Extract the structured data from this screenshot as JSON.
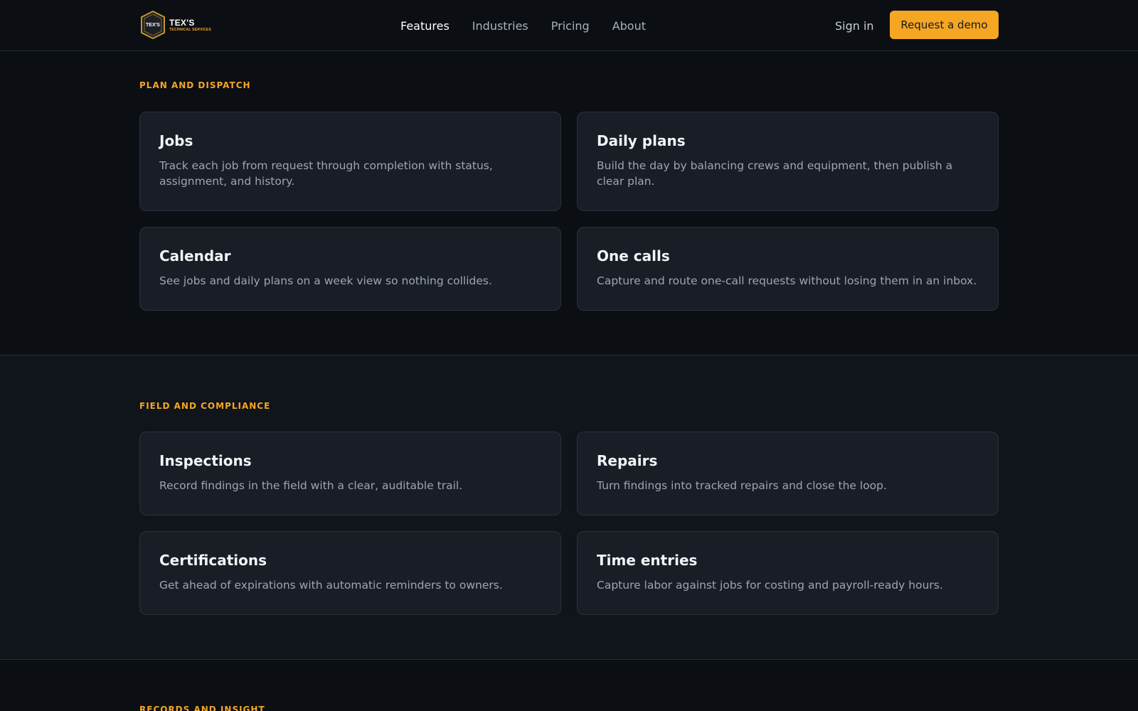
{
  "header": {
    "logo": {
      "name": "TEX'S",
      "tagline": "TECHNICAL SERVICES",
      "badge_text": "TEX'S",
      "icon": "shield-badge-logo"
    },
    "nav": [
      {
        "label": "Features",
        "active": true
      },
      {
        "label": "Industries",
        "active": false
      },
      {
        "label": "Pricing",
        "active": false
      },
      {
        "label": "About",
        "active": false
      }
    ],
    "sign_in": "Sign in",
    "cta": "Request a demo"
  },
  "sections": [
    {
      "eyebrow": "PLAN AND DISPATCH",
      "cards": [
        {
          "title": "Jobs",
          "description": "Track each job from request through completion with status, assignment, and history."
        },
        {
          "title": "Daily plans",
          "description": "Build the day by balancing crews and equipment, then publish a clear plan."
        },
        {
          "title": "Calendar",
          "description": "See jobs and daily plans on a week view so nothing collides."
        },
        {
          "title": "One calls",
          "description": "Capture and route one-call requests without losing them in an inbox."
        }
      ]
    },
    {
      "eyebrow": "FIELD AND COMPLIANCE",
      "cards": [
        {
          "title": "Inspections",
          "description": "Record findings in the field with a clear, auditable trail."
        },
        {
          "title": "Repairs",
          "description": "Turn findings into tracked repairs and close the loop."
        },
        {
          "title": "Certifications",
          "description": "Get ahead of expirations with automatic reminders to owners."
        },
        {
          "title": "Time entries",
          "description": "Capture labor against jobs for costing and payroll-ready hours."
        }
      ]
    },
    {
      "eyebrow": "RECORDS AND INSIGHT"
    }
  ],
  "colors": {
    "accent": "#f5a623",
    "background": "#0b0e13",
    "card": "#181d26",
    "border": "#2b313c"
  }
}
